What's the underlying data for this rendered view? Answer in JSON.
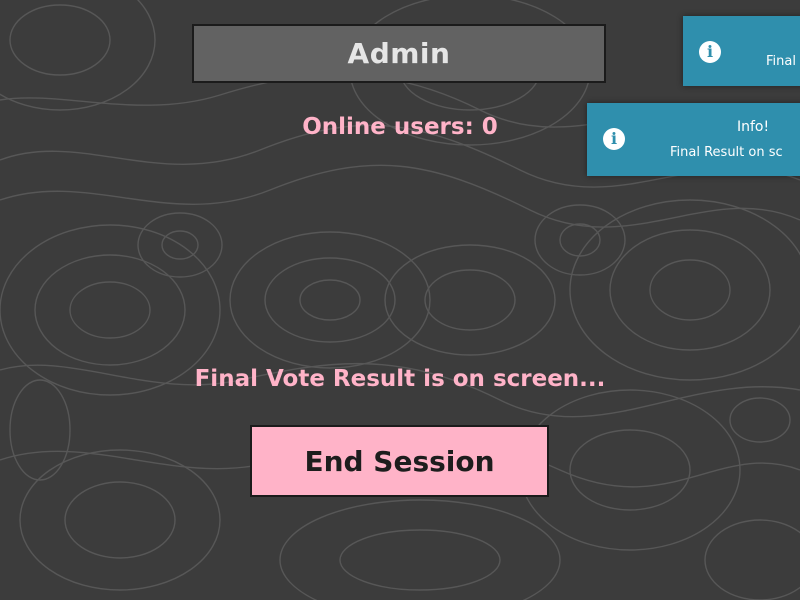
{
  "header": {
    "title": "Admin"
  },
  "status": {
    "online_users": "Online users: 0",
    "message": "Final Vote Result is on screen..."
  },
  "actions": {
    "end_session_label": "End Session"
  },
  "toasts": [
    {
      "icon": "info-icon",
      "title": "",
      "message": "Final"
    },
    {
      "icon": "info-icon",
      "title": "Info!",
      "message": "Final Result on sc"
    }
  ],
  "colors": {
    "background": "#3c3c3c",
    "accent_pink": "#ffb3c8",
    "header_gray": "#626262",
    "toast_blue": "#2f8fad"
  }
}
